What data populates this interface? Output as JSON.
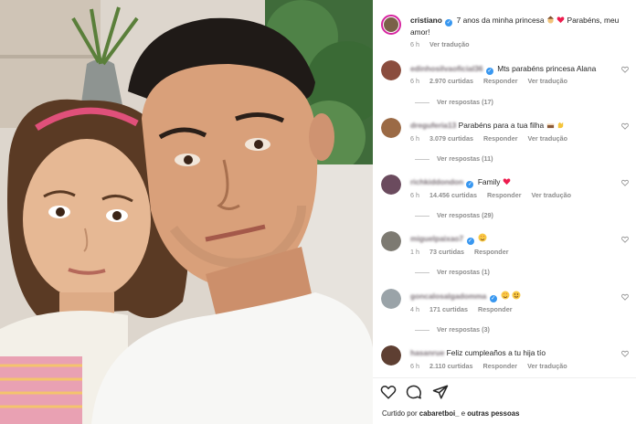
{
  "post": {
    "author": "cristiano",
    "caption_text": "7 anos da minha princesa",
    "caption_text2": "Parabéns, meu amor!",
    "time": "6 h",
    "see_translation": "Ver tradução"
  },
  "comments": [
    {
      "username": "edinhosilvaoficial36",
      "verified": true,
      "text": "Mts parabéns princesa Alana",
      "time": "6 h",
      "likes": "2.970 curtidas",
      "reply": "Responder",
      "translate": "Ver tradução",
      "replies": "Ver respostas (17)",
      "avatar_color": "#8a4d3e"
    },
    {
      "username": "dreguferia13",
      "verified": false,
      "text": "Parabéns para a tua filha",
      "time": "6 h",
      "likes": "3.079 curtidas",
      "reply": "Responder",
      "translate": "Ver tradução",
      "replies": "Ver respostas (11)",
      "avatar_color": "#9b6a45"
    },
    {
      "username": "richkiddondon",
      "verified": true,
      "text": "Family",
      "time": "6 h",
      "likes": "14.456 curtidas",
      "reply": "Responder",
      "translate": "Ver tradução",
      "replies": "Ver respostas (29)",
      "avatar_color": "#6b4b5e"
    },
    {
      "username": "miguelpaixao7",
      "verified": true,
      "text": "",
      "time": "1 h",
      "likes": "73 curtidas",
      "reply": "Responder",
      "translate": "",
      "replies": "Ver respostas (1)",
      "avatar_color": "#7d7a72"
    },
    {
      "username": "goncalosalgadomma",
      "verified": true,
      "text": "",
      "time": "4 h",
      "likes": "171 curtidas",
      "reply": "Responder",
      "translate": "",
      "replies": "Ver respostas (3)",
      "avatar_color": "#9aa3a8"
    },
    {
      "username": "hasanrue",
      "verified": false,
      "text": "Feliz cumpleaños a tu hija tío",
      "time": "6 h",
      "likes": "2.110 curtidas",
      "reply": "Responder",
      "translate": "Ver tradução",
      "replies": "",
      "avatar_color": "#5e3f32"
    }
  ],
  "footer": {
    "liked_by_prefix": "Curtido por",
    "liked_by_user": "cabaretboi_",
    "liked_by_suffix": "e",
    "liked_by_others": "outras pessoas"
  },
  "colors": {
    "verified": "#3897f0",
    "heart": "#ed1c4e",
    "ring": "#d6249f",
    "meta": "#8e8e8e"
  },
  "icons": [
    "heart-icon",
    "comment-icon",
    "share-icon",
    "verified-icon",
    "heart-emoji",
    "princess-emoji",
    "cake-emoji",
    "clap-emoji",
    "starstruck-emoji"
  ]
}
